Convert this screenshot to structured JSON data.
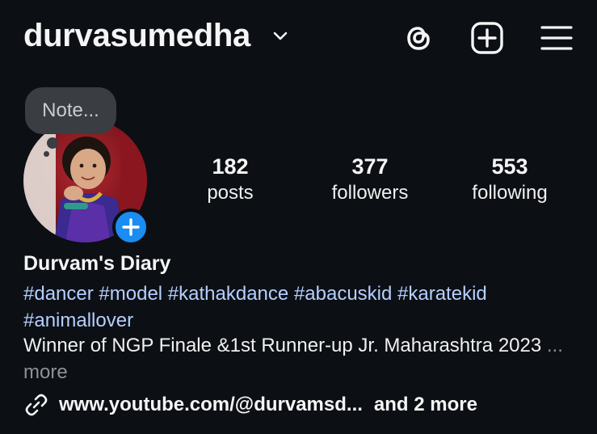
{
  "header": {
    "username": "durvasumedha",
    "icons": [
      "chevron-down-icon",
      "threads-icon",
      "create-plus-icon",
      "menu-icon"
    ]
  },
  "profile": {
    "note_placeholder": "Note...",
    "stats": {
      "posts": {
        "count": "182",
        "label": "posts"
      },
      "followers": {
        "count": "377",
        "label": "followers"
      },
      "following": {
        "count": "553",
        "label": "following"
      }
    },
    "display_name": "Durvam's Diary",
    "hashtags": [
      "#dancer",
      "#model",
      "#kathakdance",
      "#abacuskid",
      "#karatekid",
      "#animallover"
    ],
    "bio_text": "Winner of NGP Finale &1st Runner-up Jr. Maharashtra 2023",
    "bio_ellipsis": " ...",
    "bio_more": " more",
    "link_text": "www.youtube.com/@durvamsd...",
    "link_more": "and 2 more"
  },
  "colors": {
    "background": "#0c0f14",
    "hashtag": "#b5cfff",
    "accent_blue": "#1b8cf2",
    "muted": "#8e9297"
  }
}
